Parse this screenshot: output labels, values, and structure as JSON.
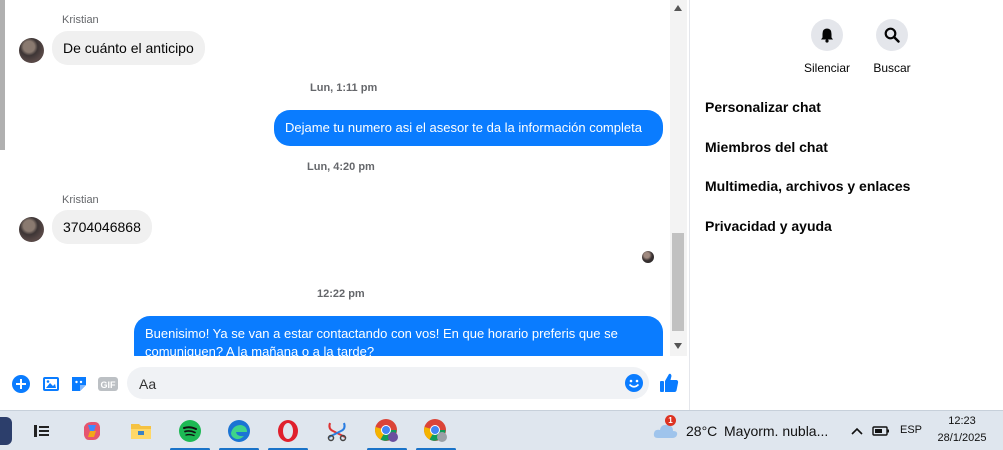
{
  "chat": {
    "messages": [
      {
        "sender": "Kristian",
        "text": "De cuánto el anticipo"
      },
      {
        "timestamp": "Lun, 1:11 pm"
      },
      {
        "outgoing": true,
        "text": "Dejame tu numero asi el asesor te da la información completa"
      },
      {
        "timestamp": "Lun, 4:20 pm"
      },
      {
        "sender": "Kristian",
        "text": "3704046868"
      },
      {
        "timestamp": "12:22 pm"
      },
      {
        "outgoing": true,
        "text": "Buenisimo! Ya se van a estar contactando con vos! En que horario preferis que se comuniquen? A la mañana o a la tarde?"
      }
    ]
  },
  "composer": {
    "placeholder": "Aa",
    "gif_label": "GIF"
  },
  "right_panel": {
    "mute_label": "Silenciar",
    "search_label": "Buscar",
    "menu": [
      "Personalizar chat",
      "Miembros del chat",
      "Multimedia, archivos y enlaces",
      "Privacidad y ayuda"
    ]
  },
  "taskbar": {
    "weather_badge": "1",
    "temperature": "28°C",
    "weather_text": "Mayorm. nubla...",
    "language": "ESP",
    "time": "12:23",
    "date": "28/1/2025"
  },
  "colors": {
    "messenger_blue": "#0a7cff",
    "incoming_bubble": "#f0f0f0",
    "taskbar_bg": "#dfe6ee"
  }
}
